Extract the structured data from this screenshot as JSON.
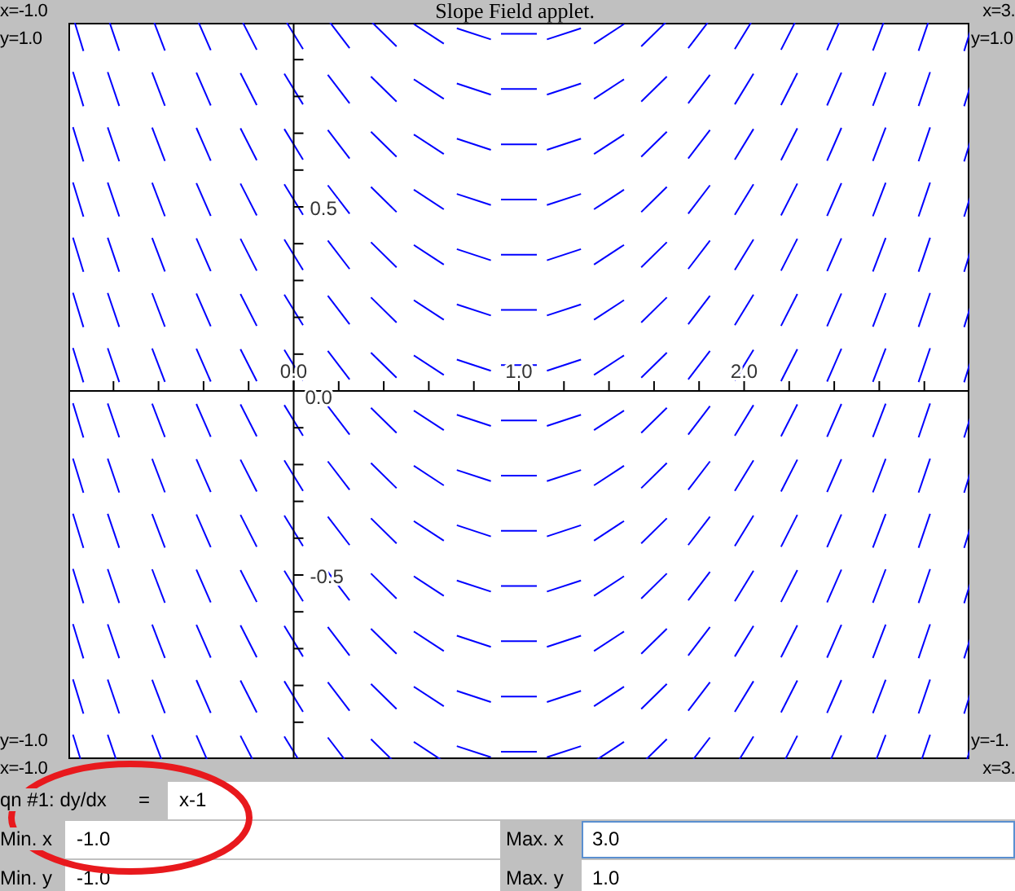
{
  "header": {
    "title": "Slope Field applet.",
    "corner_left": "x=-1.0",
    "corner_right": "x=3."
  },
  "plot": {
    "top_left": "y=1.0",
    "top_right": "y=1.0",
    "bottom_left": "y=-1.0",
    "bottom_right": "y=-1.",
    "x_tick_labels": [
      "0.0",
      "1.0",
      "2.0"
    ],
    "y_tick_labels": [
      "0.5",
      "0.0",
      "-0.5"
    ]
  },
  "footer": {
    "left": "x=-1.0",
    "right": "x=3."
  },
  "equation": {
    "label": "qn #1: dy/dx",
    "equals": "=",
    "value": "x-1"
  },
  "ranges": [
    {
      "fields": [
        {
          "label": "Min. x",
          "value": "-1.0",
          "focused": false
        },
        {
          "label": "Max. x",
          "value": "3.0",
          "focused": true
        }
      ]
    },
    {
      "fields": [
        {
          "label": "Min. y",
          "value": "-1.0",
          "focused": false
        },
        {
          "label": "Max. y",
          "value": "1.0",
          "focused": false
        }
      ]
    }
  ]
}
